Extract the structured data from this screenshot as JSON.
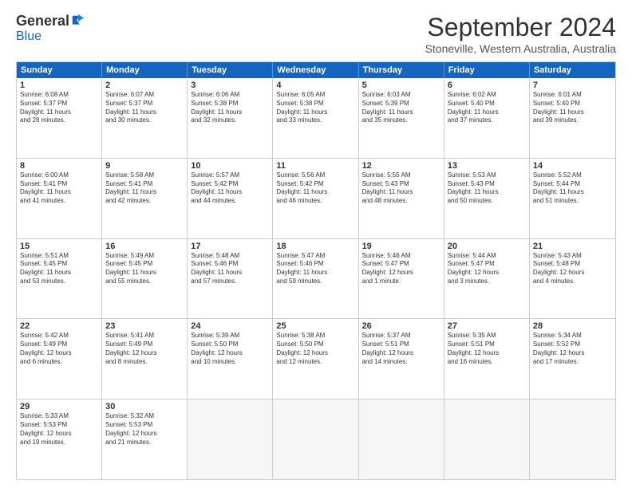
{
  "logo": {
    "general": "General",
    "blue": "Blue"
  },
  "header": {
    "month": "September 2024",
    "location": "Stoneville, Western Australia, Australia"
  },
  "weekdays": [
    "Sunday",
    "Monday",
    "Tuesday",
    "Wednesday",
    "Thursday",
    "Friday",
    "Saturday"
  ],
  "rows": [
    [
      {
        "day": "",
        "empty": true
      },
      {
        "day": "2",
        "info": "Sunrise: 6:07 AM\nSunset: 5:37 PM\nDaylight: 11 hours\nand 30 minutes."
      },
      {
        "day": "3",
        "info": "Sunrise: 6:06 AM\nSunset: 5:38 PM\nDaylight: 11 hours\nand 32 minutes."
      },
      {
        "day": "4",
        "info": "Sunrise: 6:05 AM\nSunset: 5:38 PM\nDaylight: 11 hours\nand 33 minutes."
      },
      {
        "day": "5",
        "info": "Sunrise: 6:03 AM\nSunset: 5:39 PM\nDaylight: 11 hours\nand 35 minutes."
      },
      {
        "day": "6",
        "info": "Sunrise: 6:02 AM\nSunset: 5:40 PM\nDaylight: 11 hours\nand 37 minutes."
      },
      {
        "day": "7",
        "info": "Sunrise: 6:01 AM\nSunset: 5:40 PM\nDaylight: 11 hours\nand 39 minutes."
      }
    ],
    [
      {
        "day": "1",
        "info": "Sunrise: 6:08 AM\nSunset: 5:37 PM\nDaylight: 11 hours\nand 28 minutes.",
        "first": true
      },
      {
        "day": "8",
        "info": "Sunrise: 6:00 AM\nSunset: 5:41 PM\nDaylight: 11 hours\nand 41 minutes."
      },
      {
        "day": "9",
        "info": "Sunrise: 5:58 AM\nSunset: 5:41 PM\nDaylight: 11 hours\nand 42 minutes."
      },
      {
        "day": "10",
        "info": "Sunrise: 5:57 AM\nSunset: 5:42 PM\nDaylight: 11 hours\nand 44 minutes."
      },
      {
        "day": "11",
        "info": "Sunrise: 5:56 AM\nSunset: 5:42 PM\nDaylight: 11 hours\nand 46 minutes."
      },
      {
        "day": "12",
        "info": "Sunrise: 5:55 AM\nSunset: 5:43 PM\nDaylight: 11 hours\nand 48 minutes."
      },
      {
        "day": "13",
        "info": "Sunrise: 5:53 AM\nSunset: 5:43 PM\nDaylight: 11 hours\nand 50 minutes."
      },
      {
        "day": "14",
        "info": "Sunrise: 5:52 AM\nSunset: 5:44 PM\nDaylight: 11 hours\nand 51 minutes."
      }
    ],
    [
      {
        "day": "15",
        "info": "Sunrise: 5:51 AM\nSunset: 5:45 PM\nDaylight: 11 hours\nand 53 minutes."
      },
      {
        "day": "16",
        "info": "Sunrise: 5:49 AM\nSunset: 5:45 PM\nDaylight: 11 hours\nand 55 minutes."
      },
      {
        "day": "17",
        "info": "Sunrise: 5:48 AM\nSunset: 5:46 PM\nDaylight: 11 hours\nand 57 minutes."
      },
      {
        "day": "18",
        "info": "Sunrise: 5:47 AM\nSunset: 5:46 PM\nDaylight: 11 hours\nand 59 minutes."
      },
      {
        "day": "19",
        "info": "Sunrise: 5:46 AM\nSunset: 5:47 PM\nDaylight: 12 hours\nand 1 minute."
      },
      {
        "day": "20",
        "info": "Sunrise: 5:44 AM\nSunset: 5:47 PM\nDaylight: 12 hours\nand 3 minutes."
      },
      {
        "day": "21",
        "info": "Sunrise: 5:43 AM\nSunset: 5:48 PM\nDaylight: 12 hours\nand 4 minutes."
      }
    ],
    [
      {
        "day": "22",
        "info": "Sunrise: 5:42 AM\nSunset: 5:49 PM\nDaylight: 12 hours\nand 6 minutes."
      },
      {
        "day": "23",
        "info": "Sunrise: 5:41 AM\nSunset: 5:49 PM\nDaylight: 12 hours\nand 8 minutes."
      },
      {
        "day": "24",
        "info": "Sunrise: 5:39 AM\nSunset: 5:50 PM\nDaylight: 12 hours\nand 10 minutes."
      },
      {
        "day": "25",
        "info": "Sunrise: 5:38 AM\nSunset: 5:50 PM\nDaylight: 12 hours\nand 12 minutes."
      },
      {
        "day": "26",
        "info": "Sunrise: 5:37 AM\nSunset: 5:51 PM\nDaylight: 12 hours\nand 14 minutes."
      },
      {
        "day": "27",
        "info": "Sunrise: 5:35 AM\nSunset: 5:51 PM\nDaylight: 12 hours\nand 16 minutes."
      },
      {
        "day": "28",
        "info": "Sunrise: 5:34 AM\nSunset: 5:52 PM\nDaylight: 12 hours\nand 17 minutes."
      }
    ],
    [
      {
        "day": "29",
        "info": "Sunrise: 5:33 AM\nSunset: 5:53 PM\nDaylight: 12 hours\nand 19 minutes."
      },
      {
        "day": "30",
        "info": "Sunrise: 5:32 AM\nSunset: 5:53 PM\nDaylight: 12 hours\nand 21 minutes."
      },
      {
        "day": "",
        "empty": true
      },
      {
        "day": "",
        "empty": true
      },
      {
        "day": "",
        "empty": true
      },
      {
        "day": "",
        "empty": true
      },
      {
        "day": "",
        "empty": true
      }
    ]
  ]
}
